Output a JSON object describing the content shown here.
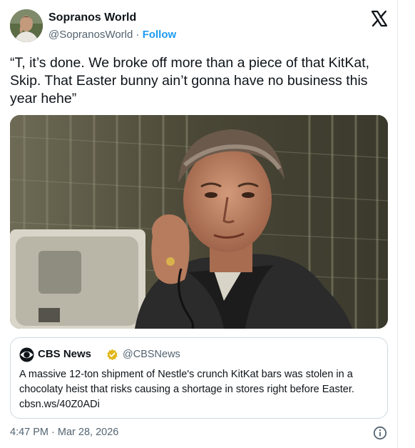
{
  "author": {
    "name": "Sopranos World",
    "handle": "@SopranosWorld",
    "separator": " · ",
    "follow_label": "Follow",
    "avatar_icon": "user-avatar-photo"
  },
  "platform_icon": "x-logo-icon",
  "tweet": {
    "text": "“T, it’s done. We broke off more than a piece of that KitKat, Skip. That Easter bunny ain’t gonna have no business this year hehe”"
  },
  "media": {
    "icon": "photo-man-on-phone",
    "colors": {
      "background": "#3c3a2c",
      "jacket": "#2b2b2b",
      "skin": "#b07a5e",
      "hair": "#5a4b40"
    }
  },
  "quoted": {
    "logo_icon": "cbs-eye-logo-icon",
    "name": "CBS News",
    "verified_icon": "gold-verified-badge-icon",
    "verified_color": "#e2b719",
    "handle": "@CBSNews",
    "text": "A massive 12-ton shipment of Nestle's crunch KitKat bars was stolen in a chocolaty heist that risks causing a shortage in stores right before Easter. cbsn.ws/40Z0ADi"
  },
  "footer": {
    "timestamp": "4:47 PM · Mar 28, 2026",
    "info_icon": "info-circle-icon"
  },
  "colors": {
    "text": "#0f1419",
    "secondary": "#536471",
    "link": "#1d9bf0",
    "border": "#cfd9de"
  }
}
